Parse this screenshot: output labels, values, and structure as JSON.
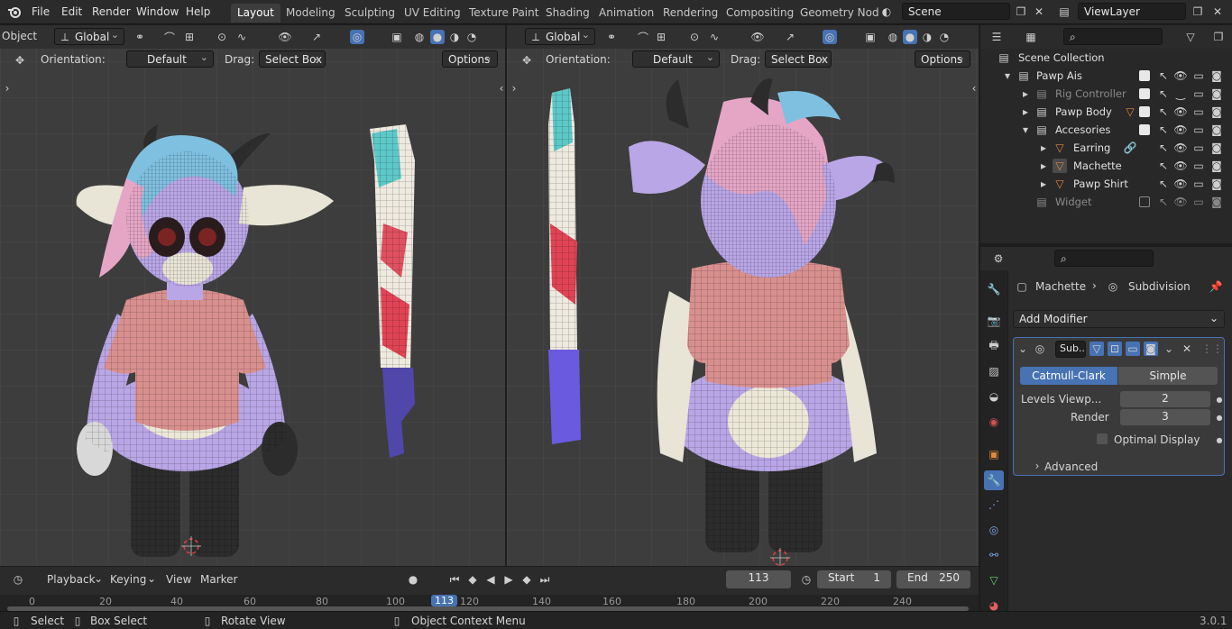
{
  "menu": [
    "File",
    "Edit",
    "Render",
    "Window",
    "Help"
  ],
  "workspaces": [
    "Layout",
    "Modeling",
    "Sculpting",
    "UV Editing",
    "Texture Paint",
    "Shading",
    "Animation",
    "Rendering",
    "Compositing",
    "Geometry Nod"
  ],
  "scene": "Scene",
  "view_layer": "ViewLayer",
  "mode": "Object",
  "viewport_left": {
    "transform": "Global",
    "orientation_label": "Orientation:",
    "orientation": "Default",
    "drag_label": "Drag:",
    "drag": "Select Box",
    "options": "Options"
  },
  "viewport_right": {
    "transform": "Global",
    "orientation_label": "Orientation:",
    "orientation": "Default",
    "drag_label": "Drag:",
    "drag": "Select Box",
    "options": "Options"
  },
  "outliner": {
    "root": "Scene Collection",
    "items": [
      {
        "label": "Pawp Ais"
      },
      {
        "label": "Rig Controller"
      },
      {
        "label": "Pawp Body"
      },
      {
        "label": "Accesories"
      },
      {
        "label": "Earring"
      },
      {
        "label": "Machette"
      },
      {
        "label": "Pawp Shirt"
      },
      {
        "label": "Widget"
      }
    ]
  },
  "properties": {
    "breadcrumb_object": "Machette",
    "breadcrumb_modifier": "Subdivision",
    "add_modifier": "Add Modifier",
    "modifier_name": "Sub...",
    "type_catmull": "Catmull-Clark",
    "type_simple": "Simple",
    "levels_viewport_label": "Levels Viewp...",
    "levels_viewport": "2",
    "render_label": "Render",
    "render": "3",
    "optimal_display": "Optimal Display",
    "advanced": "Advanced"
  },
  "timeline": {
    "playback": "Playback",
    "keying": "Keying",
    "view": "View",
    "marker": "Marker",
    "current_frame": "113",
    "start_label": "Start",
    "start": "1",
    "end_label": "End",
    "end": "250",
    "ruler": [
      "0",
      "20",
      "40",
      "60",
      "80",
      "100",
      "113",
      "120",
      "140",
      "160",
      "180",
      "200",
      "220",
      "240"
    ]
  },
  "status": {
    "select": "Select",
    "box_select": "Box Select",
    "rotate_view": "Rotate View",
    "context_menu": "Object Context Menu",
    "version": "3.0.1"
  },
  "colors": {
    "accent": "#4772b3",
    "character_body": "#b9a6e6",
    "shirt": "#d8908e",
    "hair_blue": "#7fc0e0",
    "hair_pink": "#e5a6c6",
    "horn": "#2f2f2f"
  }
}
